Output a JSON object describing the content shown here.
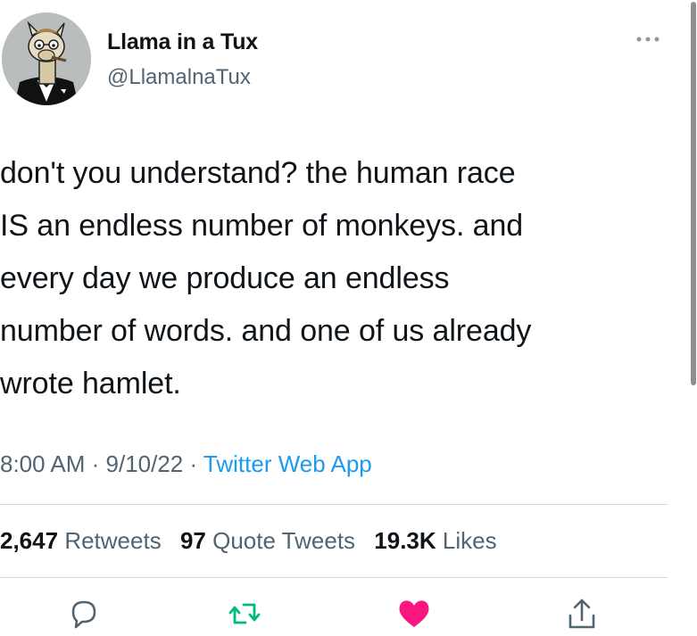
{
  "author": {
    "display_name": "Llama in a Tux",
    "handle": "@LlamalnaTux",
    "avatar_icon": "llama-in-tuxedo-avatar"
  },
  "more_icon": "more-options-icon",
  "tweet": {
    "lines": [
      "don't you understand? the human race",
      "IS an endless number of monkeys. and",
      "every day we produce an endless",
      "number of words. and one of us already",
      "wrote hamlet."
    ]
  },
  "meta": {
    "time": "8:00 AM",
    "sep1": " · ",
    "date": "9/10/22",
    "sep2": " · ",
    "source": "Twitter Web App"
  },
  "stats": {
    "retweets_count": "2,647",
    "retweets_label": "Retweets",
    "quotes_count": "97",
    "quotes_label": "Quote Tweets",
    "likes_count": "19.3K",
    "likes_label": "Likes"
  },
  "actions": {
    "reply_icon": "reply-icon",
    "retweet_icon": "retweet-icon",
    "like_icon": "heart-icon",
    "share_icon": "share-icon"
  },
  "colors": {
    "text": "#0f1419",
    "secondary": "#536471",
    "link": "#1d9bf0",
    "retweet": "#00ba7c",
    "like": "#f91880",
    "divider": "#cfd9de"
  }
}
